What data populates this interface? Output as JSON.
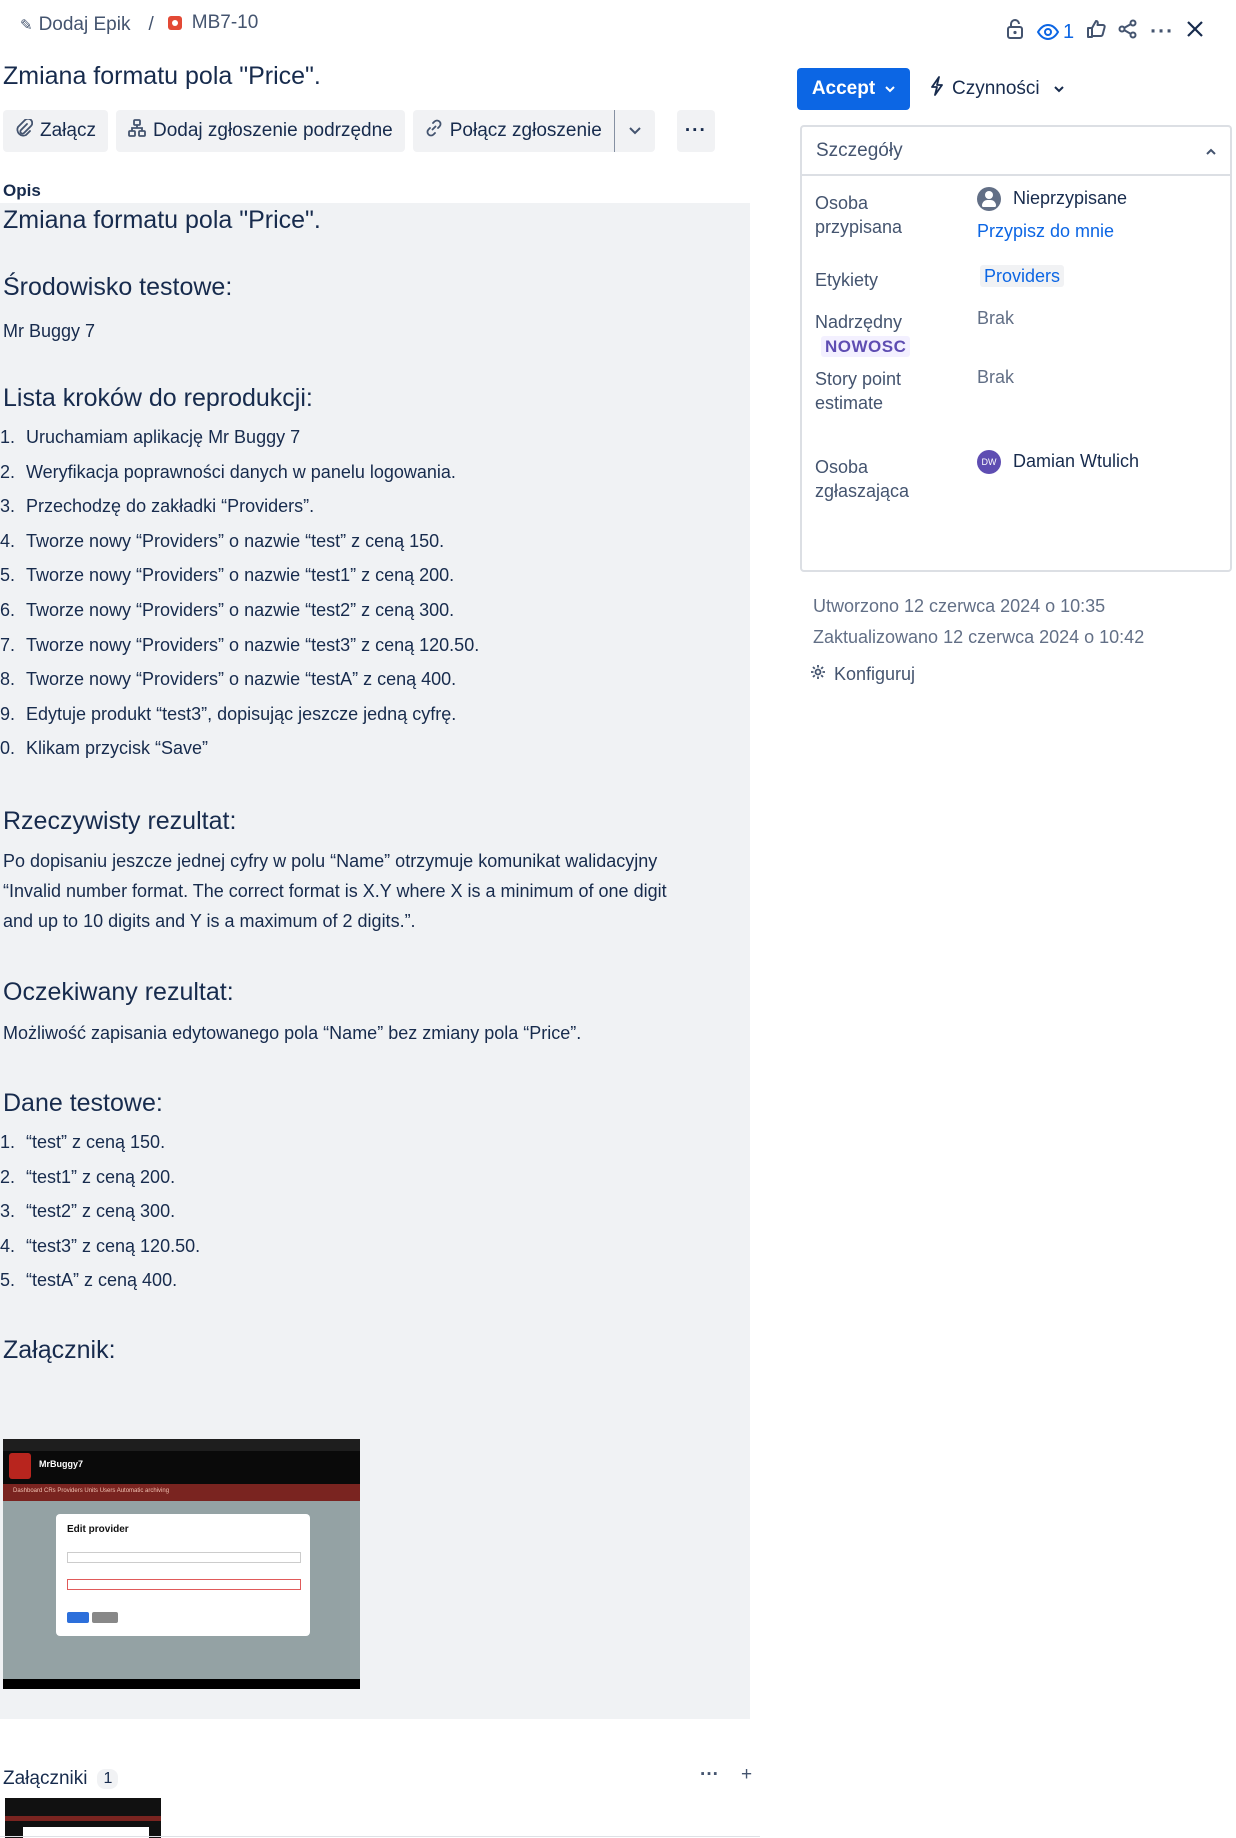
{
  "breadcrumb": {
    "parent": "Dodaj Epik",
    "separator": "/",
    "issue_key": "MB7-10"
  },
  "header": {
    "watchers_count": "1"
  },
  "issue": {
    "title": "Zmiana formatu pola \"Price\"."
  },
  "toolbar": {
    "attach": "Załącz",
    "add_child": "Dodaj zgłoszenie podrzędne",
    "link_issue": "Połącz zgłoszenie",
    "more": "···"
  },
  "description": {
    "label": "Opis",
    "heading": "Zmiana formatu pola \"Price\".",
    "env_heading": "Środowisko testowe:",
    "env_value": "Mr Buggy 7",
    "steps_heading": "Lista kroków do reprodukcji:",
    "steps": [
      {
        "n": "1.",
        "t": "Uruchamiam aplikację Mr Buggy 7"
      },
      {
        "n": "2.",
        "t": "Weryfikacja poprawności danych w panelu logowania."
      },
      {
        "n": "3.",
        "t": "Przechodzę do zakładki “Providers”."
      },
      {
        "n": "4.",
        "t": "Tworze nowy “Providers” o nazwie “test” z ceną 150."
      },
      {
        "n": "5.",
        "t": "Tworze nowy “Providers” o nazwie “test1” z ceną 200."
      },
      {
        "n": "6.",
        "t": "Tworze nowy “Providers” o nazwie “test2” z ceną 300."
      },
      {
        "n": "7.",
        "t": "Tworze nowy “Providers” o nazwie “test3” z ceną 120.50."
      },
      {
        "n": "8.",
        "t": "Tworze nowy “Providers” o nazwie “testA” z ceną 400."
      },
      {
        "n": "9.",
        "t": "Edytuje produkt “test3”, dopisując jeszcze jedną cyfrę."
      },
      {
        "n": "0.",
        "t": "Klikam przycisk “Save”"
      }
    ],
    "actual_heading": "Rzeczywisty rezultat:",
    "actual_lines": [
      "Po dopisaniu jeszcze jednej cyfry w polu “Name” otrzymuje komunikat walidacyjny",
      "“Invalid number format. The correct format is X.Y where X is a minimum of one digit",
      "and up to 10 digits and Y is a maximum of 2 digits.”."
    ],
    "expected_heading": "Oczekiwany rezultat:",
    "expected_text": "Możliwość zapisania edytowanego pola “Name” bez zmiany pola “Price”.",
    "data_heading": "Dane testowe:",
    "data_items": [
      {
        "n": "1.",
        "t": "“test” z ceną 150."
      },
      {
        "n": "2.",
        "t": "“test1” z ceną 200."
      },
      {
        "n": "3.",
        "t": "“test2” z ceną 300."
      },
      {
        "n": "4.",
        "t": "“test3” z ceną 120.50."
      },
      {
        "n": "5.",
        "t": "“testA” z ceną 400."
      }
    ],
    "attachment_heading": "Załącznik:",
    "screenshot": {
      "app_title": "MrBuggy 7",
      "brand": "MrBuggy7",
      "nav": "Dashboard   CRs   Providers   Units   Users   Automatic archiving",
      "modal_title": "Edit provider"
    }
  },
  "attachments": {
    "label": "Załączniki",
    "count": "1",
    "more": "···",
    "add": "+"
  },
  "right": {
    "accept": "Accept",
    "actions": "Czynności",
    "details_title": "Szczegóły",
    "assignee_label_1": "Osoba",
    "assignee_label_2": "przypisana",
    "assignee_value": "Nieprzypisane",
    "assign_to_me": "Przypisz do mnie",
    "labels_label": "Etykiety",
    "labels_value": "Providers",
    "parent_label": "Nadrzędny",
    "parent_epic": "NOWOSC",
    "parent_value": "Brak",
    "sp_label_1": "Story point",
    "sp_label_2": "estimate",
    "sp_value": "Brak",
    "reporter_label_1": "Osoba",
    "reporter_label_2": "zgłaszająca",
    "reporter_initials": "DW",
    "reporter_value": "Damian Wtulich",
    "created": "Utworzono 12 czerwca 2024 o 10:35",
    "updated": "Zaktualizowano 12 czerwca 2024 o 10:42",
    "configure": "Konfiguruj"
  }
}
